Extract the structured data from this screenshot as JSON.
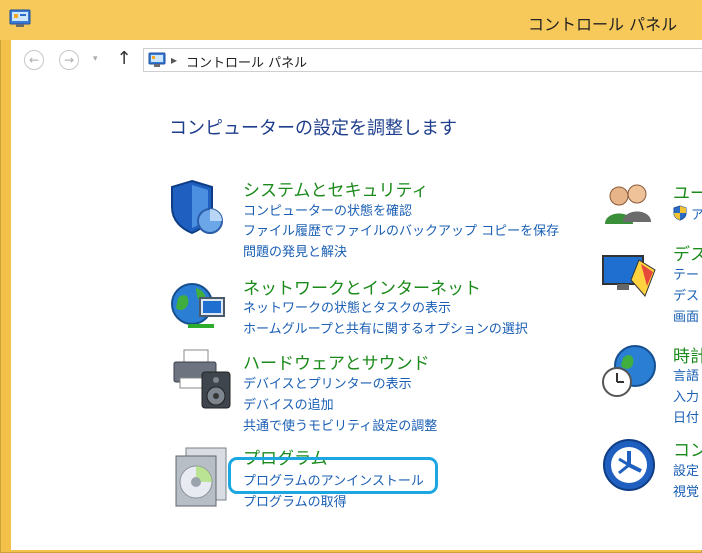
{
  "window": {
    "title": "コントロール パネル"
  },
  "nav": {
    "back_label": "←",
    "forward_label": "→",
    "recent_label": "▾",
    "up_label": "↑",
    "address": {
      "chevron": "▸",
      "path": "コントロール パネル"
    }
  },
  "main": {
    "heading": "コンピューターの設定を調整します",
    "left_categories": [
      {
        "title": "システムとセキュリティ",
        "links": [
          "コンピューターの状態を確認",
          "ファイル履歴でファイルのバックアップ コピーを保存",
          "問題の発見と解決"
        ]
      },
      {
        "title": "ネットワークとインターネット",
        "links": [
          "ネットワークの状態とタスクの表示",
          "ホームグループと共有に関するオプションの選択"
        ]
      },
      {
        "title": "ハードウェアとサウンド",
        "links": [
          "デバイスとプリンターの表示",
          "デバイスの追加",
          "共通で使うモビリティ設定の調整"
        ]
      },
      {
        "title": "プログラム",
        "links": [
          "プログラムのアンインストール",
          "プログラムの取得"
        ]
      }
    ],
    "right_categories": [
      {
        "title": "ユー",
        "links": [
          "ア"
        ]
      },
      {
        "title": "デス",
        "links": [
          "テー",
          "デス",
          "画面"
        ]
      },
      {
        "title": "時計",
        "links": [
          "言語",
          "入力",
          "日付"
        ]
      },
      {
        "title": "コン",
        "links": [
          "設定",
          "視覚"
        ]
      }
    ]
  },
  "colors": {
    "titlebar": "#f7c95a",
    "category_title": "#1a8a1a",
    "link": "#1a5fb4",
    "heading": "#1e3e8c",
    "highlight": "#1da7e2"
  }
}
